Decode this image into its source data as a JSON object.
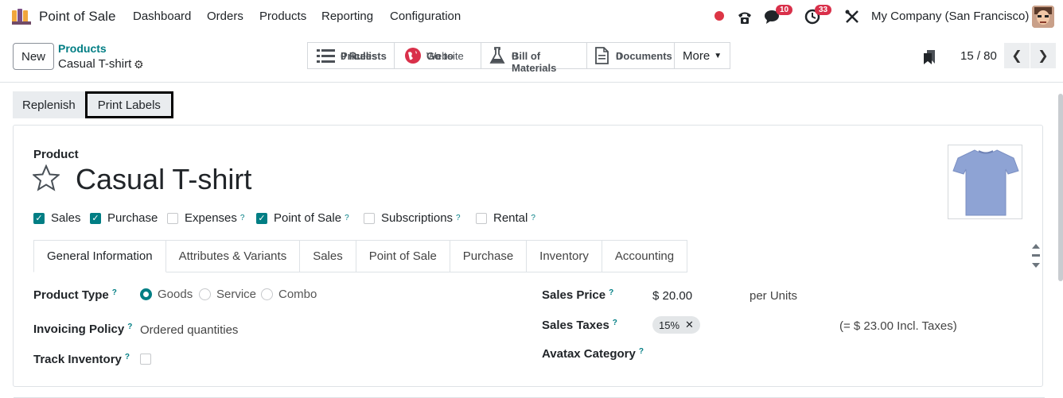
{
  "topbar": {
    "app_name": "Point of Sale",
    "menu": [
      "Dashboard",
      "Orders",
      "Products",
      "Reporting",
      "Configuration"
    ],
    "messages_badge": "10",
    "activity_badge": "33",
    "company": "My Company (San Francisco)"
  },
  "control": {
    "new_label": "New",
    "breadcrumb_parent": "Products",
    "breadcrumb_current": "Casual T-shirt",
    "smart_buttons": [
      {
        "label": "Pricelists",
        "count": "0 Rules",
        "icon": "list-icon"
      },
      {
        "label": "Go to",
        "count": "Website",
        "icon": "globe-icon"
      },
      {
        "label": "Bill of Materials",
        "count": "0",
        "icon": "flask-icon"
      },
      {
        "label": "Documents",
        "count": "0",
        "icon": "document-icon"
      }
    ],
    "more_label": "More",
    "pager": "15 / 80"
  },
  "actions": {
    "replenish": "Replenish",
    "print_labels": "Print Labels"
  },
  "product": {
    "section_label": "Product",
    "name": "Casual T-shirt",
    "checkboxes": [
      {
        "label": "Sales",
        "checked": true,
        "help": false
      },
      {
        "label": "Purchase",
        "checked": true,
        "help": false
      },
      {
        "label": "Expenses",
        "checked": false,
        "help": true
      },
      {
        "label": "Point of Sale",
        "checked": true,
        "help": true
      },
      {
        "label": "Subscriptions",
        "checked": false,
        "help": true
      },
      {
        "label": "Rental",
        "checked": false,
        "help": true
      }
    ]
  },
  "tabs": [
    "General Information",
    "Attributes & Variants",
    "Sales",
    "Point of Sale",
    "Purchase",
    "Inventory",
    "Accounting"
  ],
  "form": {
    "product_type_label": "Product Type",
    "product_type_options": [
      "Goods",
      "Service",
      "Combo"
    ],
    "product_type_selected": "Goods",
    "invoicing_policy_label": "Invoicing Policy",
    "invoicing_policy_value": "Ordered quantities",
    "track_inventory_label": "Track Inventory",
    "sales_price_label": "Sales Price",
    "sales_price_value": "$ 20.00",
    "sales_price_unit": "per Units",
    "sales_taxes_label": "Sales Taxes",
    "sales_taxes_tag": "15%",
    "sales_taxes_incl": "(= $ 23.00 Incl. Taxes)",
    "avatax_label": "Avatax Category"
  },
  "colors": {
    "accent": "#017e84",
    "badge": "#d9304a",
    "highlight_border": "#000000"
  }
}
